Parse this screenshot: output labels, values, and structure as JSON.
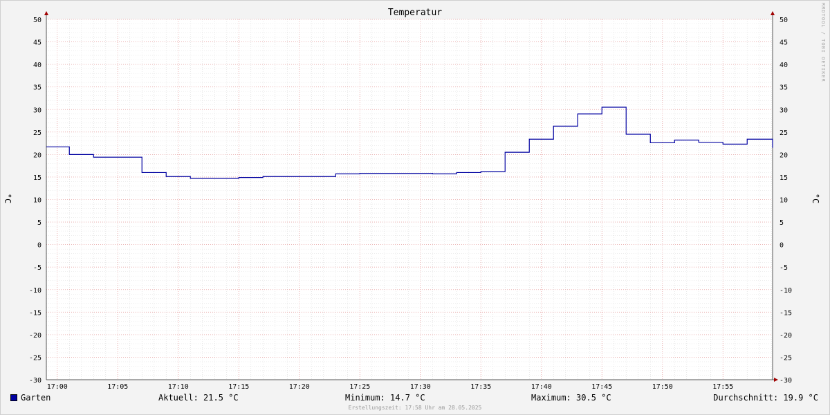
{
  "chart_data": {
    "type": "line",
    "title": "Temperatur",
    "ylabel": "°C",
    "ylabel_right": "°C",
    "ylim": [
      -30,
      50
    ],
    "yticks": [
      -30,
      -25,
      -20,
      -15,
      -10,
      -5,
      0,
      5,
      10,
      15,
      20,
      25,
      30,
      35,
      40,
      45,
      50
    ],
    "xrange_minutes": [
      16.1,
      76.1
    ],
    "x_tick_minutes": [
      17,
      22,
      27,
      32,
      37,
      42,
      47,
      52,
      57,
      62,
      67,
      72
    ],
    "x_tick_labels": [
      "17:00",
      "17:05",
      "17:10",
      "17:15",
      "17:20",
      "17:25",
      "17:30",
      "17:35",
      "17:40",
      "17:45",
      "17:50",
      "17:55"
    ],
    "grid": true,
    "step": true,
    "series": [
      {
        "name": "Garten",
        "color": "#0000a0",
        "x_minutes": [
          16.1,
          18,
          20,
          24,
          26,
          28,
          32,
          34,
          36,
          40,
          42,
          46,
          48,
          50,
          52,
          54,
          56,
          58,
          60,
          62,
          64,
          66,
          68,
          70,
          72,
          74,
          76.1
        ],
        "values": [
          21.7,
          20.0,
          19.4,
          16.0,
          15.1,
          14.7,
          14.9,
          15.1,
          15.1,
          15.7,
          15.8,
          15.8,
          15.7,
          16.0,
          16.2,
          20.5,
          23.4,
          26.3,
          29.0,
          30.5,
          24.5,
          22.6,
          23.2,
          22.7,
          22.3,
          23.4,
          21.5
        ]
      }
    ]
  },
  "watermark": "RRDTOOL / TOBI OETIKER",
  "legend": {
    "series_name": "Garten",
    "current": "Aktuell: 21.5 °C",
    "minimum": "Minimum: 14.7 °C",
    "maximum": "Maximum: 30.5 °C",
    "average": "Durchschnitt: 19.9 °C"
  },
  "creation_time": "Erstellungszeit: 17:58 Uhr am 28.05.2025"
}
